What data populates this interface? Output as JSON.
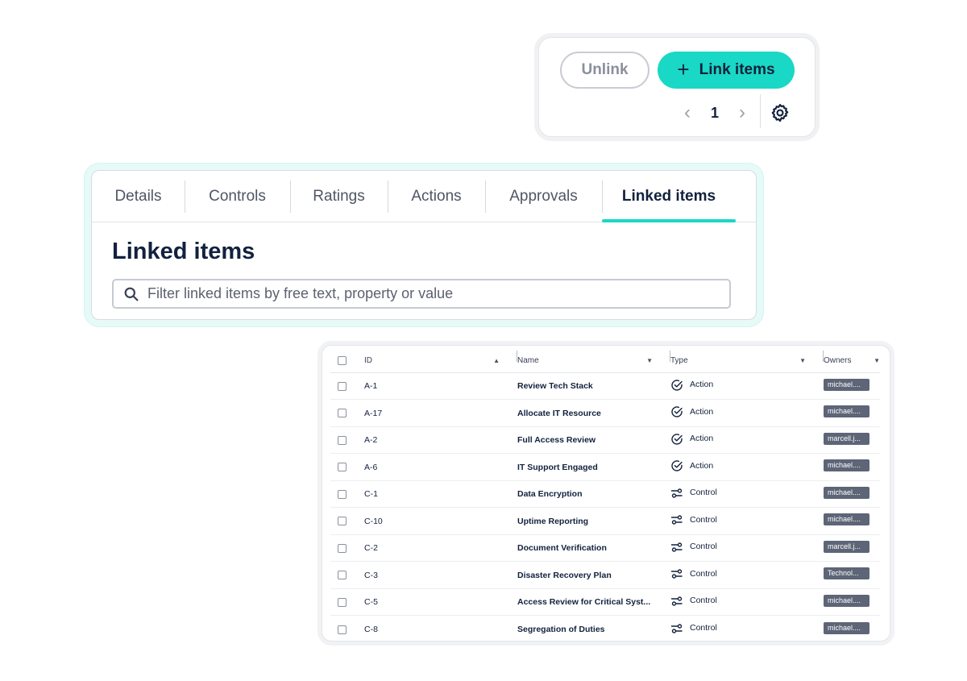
{
  "toolbar": {
    "unlink_label": "Unlink",
    "link_items_label": "Link items",
    "link_items_icon": "plus-icon",
    "prev_icon": "chevron-left-icon",
    "page": "1",
    "next_icon": "chevron-right-icon",
    "settings_icon": "gear-icon",
    "accent_color": "#19d8c5"
  },
  "tabs": [
    {
      "label": "Details"
    },
    {
      "label": "Controls"
    },
    {
      "label": "Ratings"
    },
    {
      "label": "Actions"
    },
    {
      "label": "Approvals"
    },
    {
      "label": "Linked items",
      "active": true
    }
  ],
  "panel": {
    "title": "Linked items",
    "search_icon": "search-icon",
    "search_placeholder": "Filter linked items by free text, property or value"
  },
  "table": {
    "columns": [
      {
        "label": "ID",
        "sort": "▲"
      },
      {
        "label": "Name",
        "sort": "▼"
      },
      {
        "label": "Type",
        "sort": "▼"
      },
      {
        "label": "Owners",
        "sort": "▼"
      }
    ],
    "rows": [
      {
        "id": "A-1",
        "name": "Review Tech Stack",
        "type": "Action",
        "type_icon": "check-circle-icon",
        "owner": "michael...."
      },
      {
        "id": "A-17",
        "name": "Allocate IT Resource",
        "type": "Action",
        "type_icon": "check-circle-icon",
        "owner": "michael...."
      },
      {
        "id": "A-2",
        "name": "Full Access Review",
        "type": "Action",
        "type_icon": "check-circle-icon",
        "owner": "marcell.j..."
      },
      {
        "id": "A-6",
        "name": "IT Support Engaged",
        "type": "Action",
        "type_icon": "check-circle-icon",
        "owner": "michael...."
      },
      {
        "id": "C-1",
        "name": "Data Encryption",
        "type": "Control",
        "type_icon": "toggle-control-icon",
        "owner": "michael...."
      },
      {
        "id": "C-10",
        "name": "Uptime Reporting",
        "type": "Control",
        "type_icon": "toggle-control-icon",
        "owner": "michael...."
      },
      {
        "id": "C-2",
        "name": "Document Verification",
        "type": "Control",
        "type_icon": "toggle-control-icon",
        "owner": "marcell.j..."
      },
      {
        "id": "C-3",
        "name": "Disaster Recovery Plan",
        "type": "Control",
        "type_icon": "toggle-control-icon",
        "owner": "Technol..."
      },
      {
        "id": "C-5",
        "name": "Access Review for Critical Syst...",
        "type": "Control",
        "type_icon": "toggle-control-icon",
        "owner": "michael...."
      },
      {
        "id": "C-8",
        "name": "Segregation of Duties",
        "type": "Control",
        "type_icon": "toggle-control-icon",
        "owner": "michael...."
      }
    ]
  }
}
